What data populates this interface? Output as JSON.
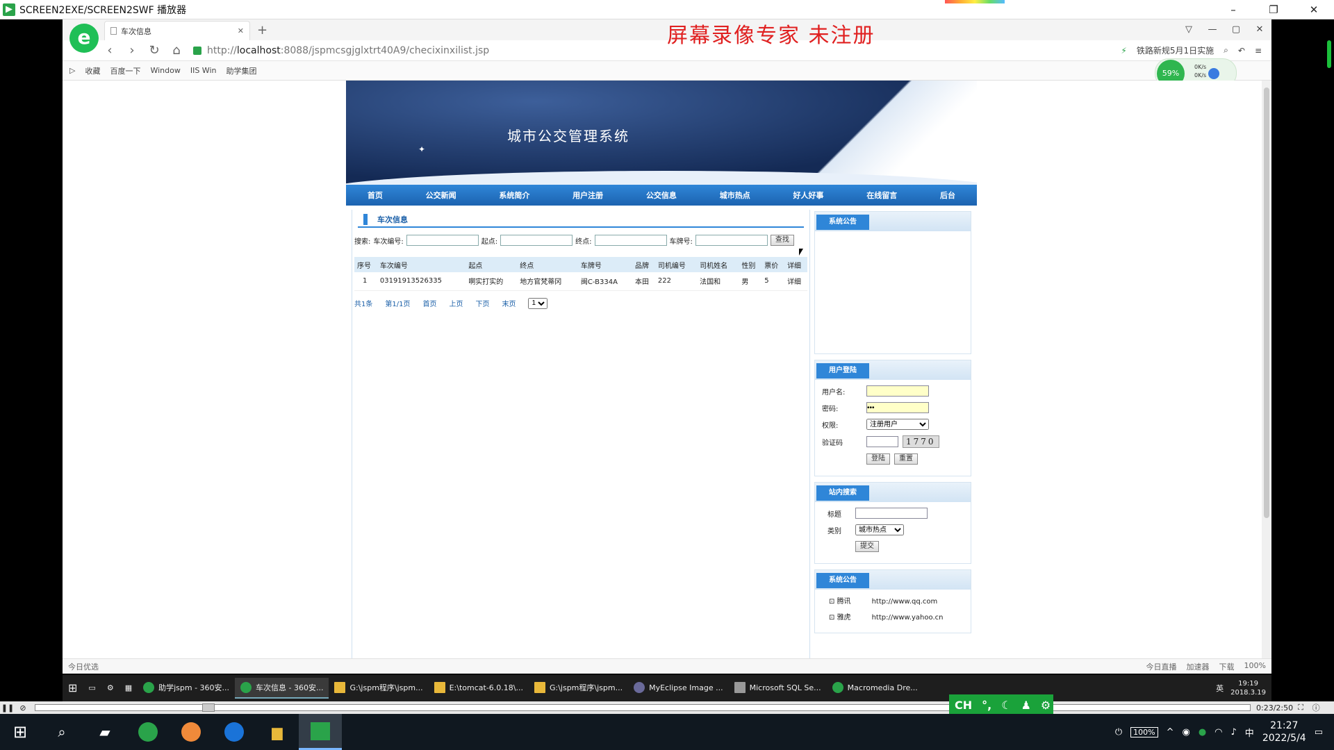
{
  "outer_window": {
    "title": "SCREEN2EXE/SCREEN2SWF 播放器",
    "min": "–",
    "max": "❐",
    "close": "✕"
  },
  "browser": {
    "tab_title": "车次信息",
    "tab_close": "✕",
    "new_tab": "+",
    "watermark": "屏幕录像专家  未注册",
    "url_prefix": "http://",
    "url_host": "localhost",
    "url_rest": ":8088/jspmcsgjglxtrt40A9/checixinxilist.jsp",
    "addr_right_text": "铁路新规5月1日实施",
    "bookmarks": [
      "收藏",
      "百度一下",
      "Window",
      "IIS Win",
      "助学集团"
    ],
    "speed": {
      "percent": "59%",
      "up": "0K/s",
      "down": "0K/s"
    },
    "status_left": "今日优选",
    "status_right": [
      "今日直播",
      "加速器",
      "下载",
      "100%"
    ]
  },
  "site": {
    "title": "城市公交管理系统",
    "nav": [
      "首页",
      "公交新闻",
      "系统简介",
      "用户注册",
      "公交信息",
      "城市热点",
      "好人好事",
      "在线留言",
      "后台"
    ],
    "section_title": "车次信息",
    "search": {
      "prefix": "搜索:",
      "f1": "车次编号:",
      "f2": "起点:",
      "f3": "终点:",
      "f4": "车牌号:",
      "button": "查找"
    },
    "table": {
      "headers": [
        "序号",
        "车次编号",
        "起点",
        "终点",
        "车牌号",
        "品牌",
        "司机编号",
        "司机姓名",
        "性别",
        "票价",
        "详细"
      ],
      "rows": [
        [
          "1",
          "03191913526335",
          "啊实打实的",
          "地方官梵蒂冈",
          "闽C-B334A",
          "本田",
          "222",
          "法国和",
          "男",
          "5",
          "详细"
        ]
      ]
    },
    "pager": {
      "total": "共1条",
      "page": "第1/1页",
      "first": "首页",
      "prev": "上页",
      "next": "下页",
      "last": "末页",
      "select": "1"
    },
    "side": {
      "notice_title": "系统公告",
      "login_title": "用户登陆",
      "username_label": "用户名:",
      "password_label": "密码:",
      "password_value": "•••",
      "role_label": "权限:",
      "role_value": "注册用户",
      "captcha_label": "验证码",
      "captcha_value": "1770",
      "login_btn": "登陆",
      "reset_btn": "重置",
      "search_title": "站内搜索",
      "kw_label": "标题",
      "cat_label": "类别",
      "cat_value": "城市热点",
      "submit_btn": "提交",
      "links_title": "系统公告",
      "links": [
        {
          "name": "腾讯",
          "url": "http://www.qq.com"
        },
        {
          "name": "雅虎",
          "url": "http://www.yahoo.cn"
        }
      ]
    }
  },
  "inner_taskbar": {
    "items": [
      "助学jspm - 360安...",
      "车次信息 - 360安...",
      "G:\\jspm程序\\jspm...",
      "E:\\tomcat-6.0.18\\...",
      "G:\\jspm程序\\jspm...",
      "MyEclipse Image ...",
      "Microsoft SQL Se...",
      "Macromedia Dre..."
    ],
    "ime": "英",
    "time": "19:19",
    "date": "2018.3.19"
  },
  "player": {
    "time": "0:23/2:50"
  },
  "ime_bar": {
    "label": "CH"
  },
  "host_taskbar": {
    "battery": "100%",
    "ime": "中",
    "time": "21:27",
    "date": "2022/5/4"
  }
}
